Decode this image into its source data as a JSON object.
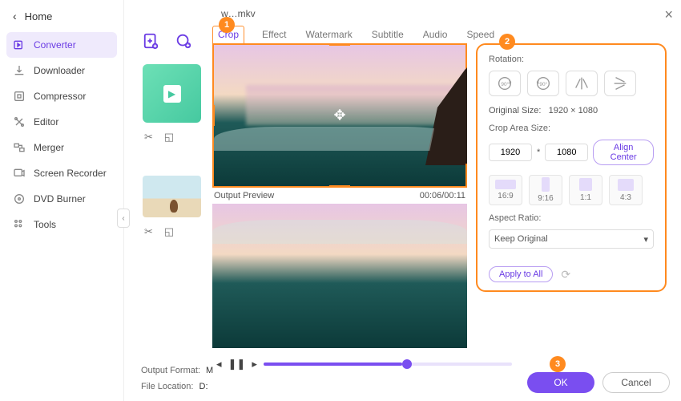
{
  "window": {
    "title": "w…mkv",
    "close": "×"
  },
  "sidebar": {
    "home": "Home",
    "items": [
      {
        "label": "Converter"
      },
      {
        "label": "Downloader"
      },
      {
        "label": "Compressor"
      },
      {
        "label": "Editor"
      },
      {
        "label": "Merger"
      },
      {
        "label": "Screen Recorder"
      },
      {
        "label": "DVD Burner"
      },
      {
        "label": "Tools"
      }
    ]
  },
  "tabs": {
    "crop": "Crop",
    "effect": "Effect",
    "watermark": "Watermark",
    "subtitle": "Subtitle",
    "audio": "Audio",
    "speed": "Speed"
  },
  "preview": {
    "output_label": "Output Preview",
    "time": "00:06/00:11"
  },
  "panel": {
    "rotation_label": "Rotation:",
    "orig_size_label": "Original Size:",
    "orig_size_value": "1920 × 1080",
    "crop_area_label": "Crop Area Size:",
    "width": "1920",
    "times": "*",
    "height": "1080",
    "align_center": "Align Center",
    "ratios": {
      "r1": "16:9",
      "r2": "9:16",
      "r3": "1:1",
      "r4": "4:3"
    },
    "aspect_label": "Aspect Ratio:",
    "aspect_value": "Keep Original",
    "apply_all": "Apply to All"
  },
  "bottom": {
    "output_format_label": "Output Format:",
    "output_format_value": "M",
    "file_location_label": "File Location:",
    "file_location_value": "D:"
  },
  "buttons": {
    "ok": "OK",
    "cancel": "Cancel"
  },
  "badges": {
    "b1": "1",
    "b2": "2",
    "b3": "3"
  },
  "collapse": "‹"
}
